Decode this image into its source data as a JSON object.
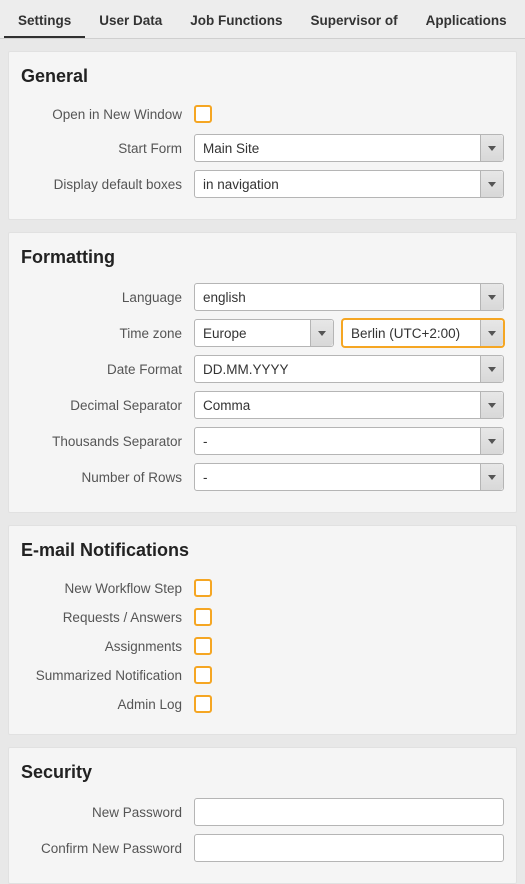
{
  "tabs": {
    "settings": "Settings",
    "user_data": "User Data",
    "job_functions": "Job Functions",
    "supervisor_of": "Supervisor of",
    "applications": "Applications"
  },
  "general": {
    "title": "General",
    "open_new_window_label": "Open in New Window",
    "start_form_label": "Start Form",
    "start_form_value": "Main Site",
    "display_boxes_label": "Display default boxes",
    "display_boxes_value": "in navigation"
  },
  "formatting": {
    "title": "Formatting",
    "language_label": "Language",
    "language_value": "english",
    "timezone_label": "Time zone",
    "timezone_region_value": "Europe",
    "timezone_city_value": "Berlin (UTC+2:00)",
    "date_format_label": "Date Format",
    "date_format_value": "DD.MM.YYYY",
    "decimal_sep_label": "Decimal Separator",
    "decimal_sep_value": "Comma",
    "thousands_sep_label": "Thousands Separator",
    "thousands_sep_value": "-",
    "num_rows_label": "Number of Rows",
    "num_rows_value": "-"
  },
  "email": {
    "title": "E-mail Notifications",
    "new_workflow_label": "New Workflow Step",
    "requests_label": "Requests / Answers",
    "assignments_label": "Assignments",
    "summarized_label": "Summarized Notification",
    "admin_log_label": "Admin Log"
  },
  "security": {
    "title": "Security",
    "new_password_label": "New Password",
    "confirm_password_label": "Confirm New Password"
  }
}
